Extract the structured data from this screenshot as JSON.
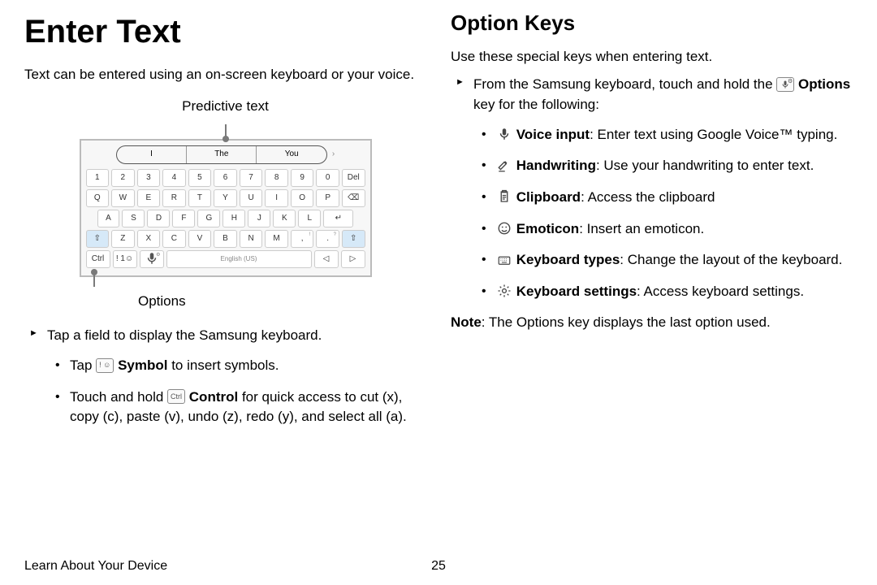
{
  "left": {
    "h1": "Enter Text",
    "intro": "Text can be entered using an on-screen keyboard or your voice.",
    "predictive_label": "Predictive text",
    "predict": {
      "a": "I",
      "b": "The",
      "c": "You"
    },
    "kbd": {
      "row1": [
        "1",
        "2",
        "3",
        "4",
        "5",
        "6",
        "7",
        "8",
        "9",
        "0",
        "Del"
      ],
      "row2": [
        "Q",
        "W",
        "E",
        "R",
        "T",
        "Y",
        "U",
        "I",
        "O",
        "P",
        "⌫"
      ],
      "row3": [
        "A",
        "S",
        "D",
        "F",
        "G",
        "H",
        "J",
        "K",
        "L",
        "↵"
      ],
      "row4": [
        "⇧",
        "Z",
        "X",
        "C",
        "V",
        "B",
        "N",
        "M",
        ", !",
        ". ?",
        "⇧"
      ],
      "row5_ctrl": "Ctrl",
      "row5_sym": "! 1☺",
      "row5_mic": "🎤",
      "row5_space": "English (US)",
      "row5_left": "◁",
      "row5_right": "▷"
    },
    "options_label": "Options",
    "step1": "Tap a field to display the Samsung keyboard.",
    "sub1_a": "Tap ",
    "sub1_b_bold": "Symbol",
    "sub1_c": " to insert symbols.",
    "sub2_a": "Touch and hold ",
    "sub2_b_bold": "Control",
    "sub2_c": " for quick access to cut (x), copy (c), paste (v), undo (z), redo (y), and select all (a).",
    "icon_sym": "! ☺",
    "icon_ctrl": "Ctrl"
  },
  "right": {
    "h2": "Option Keys",
    "intro": "Use these special keys when entering text.",
    "step1_a": "From the Samsung keyboard, touch and hold the ",
    "step1_b_bold": "Options",
    "step1_c": " key for the following:",
    "icon_mic_small": "🎤",
    "items": {
      "voice_bold": "Voice input",
      "voice_rest": ": Enter text using Google Voice™ typing.",
      "hand_bold": "Handwriting",
      "hand_rest": ": Use your handwriting to enter text.",
      "clip_bold": "Clipboard",
      "clip_rest": ": Access the clipboard",
      "emot_bold": "Emoticon",
      "emot_rest": ": Insert an emoticon.",
      "kbdt_bold": "Keyboard types",
      "kbdt_rest": ": Change the layout of the keyboard.",
      "kbds_bold": "Keyboard settings",
      "kbds_rest": ": Access keyboard settings."
    },
    "note_bold": "Note",
    "note_rest": ": The Options key displays the last option used."
  },
  "footer": {
    "section": "Learn About Your Device",
    "page": "25"
  }
}
